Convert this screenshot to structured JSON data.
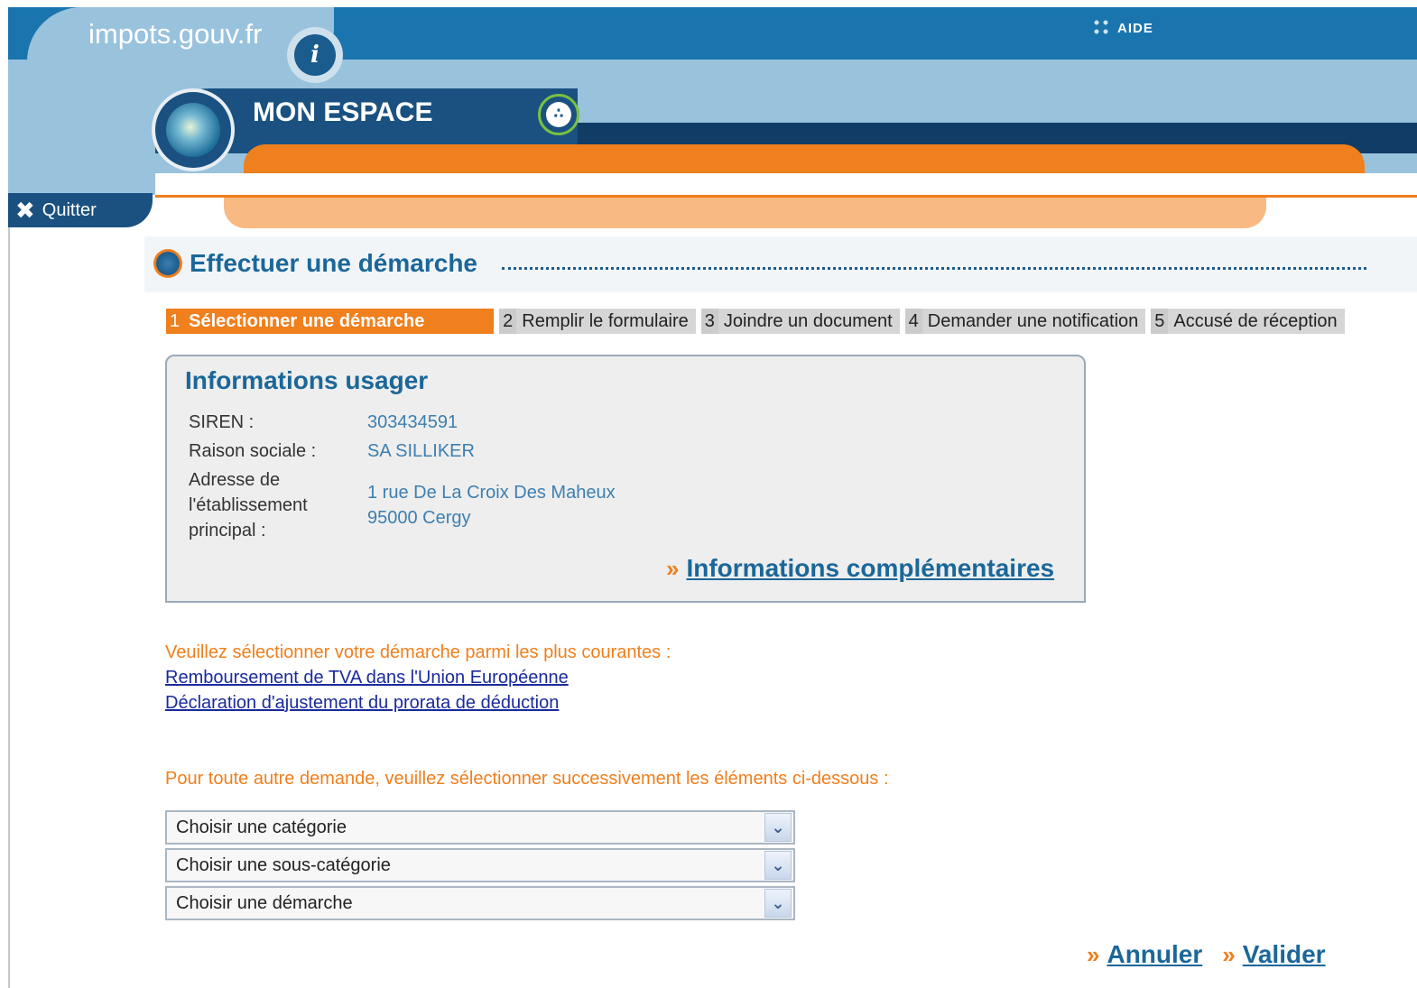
{
  "header": {
    "logo_text": "impots.gouv.fr",
    "logo_mark": "i",
    "help_label": "AIDE",
    "space_title": "MON ESPACE",
    "quit_label": "Quitter"
  },
  "section": {
    "title": "Effectuer une démarche"
  },
  "steps": [
    {
      "num": "1",
      "label": "Sélectionner une démarche",
      "active": true
    },
    {
      "num": "2",
      "label": "Remplir le formulaire",
      "active": false
    },
    {
      "num": "3",
      "label": "Joindre un document",
      "active": false
    },
    {
      "num": "4",
      "label": "Demander une notification",
      "active": false
    },
    {
      "num": "5",
      "label": "Accusé de réception",
      "active": false
    }
  ],
  "user_info": {
    "title": "Informations usager",
    "siren_label": "SIREN :",
    "siren_value": "303434591",
    "raison_label": "Raison sociale :",
    "raison_value": "SA SILLIKER",
    "address_label_1": "Adresse de",
    "address_label_2": "l'établissement",
    "address_label_3": "principal :",
    "address_line1": "1 rue De La Croix Des Maheux",
    "address_line2": "95000 Cergy",
    "more_link": "Informations complémentaires"
  },
  "common": {
    "prompt": "Veuillez sélectionner votre démarche parmi les plus courantes :",
    "links": [
      "Remboursement de TVA dans l'Union Européenne",
      "Déclaration d'ajustement du prorata de déduction"
    ]
  },
  "other": {
    "prompt": "Pour toute autre demande, veuillez sélectionner successivement les éléments ci-dessous :",
    "selects": [
      "Choisir une catégorie",
      "Choisir une sous-catégorie",
      "Choisir une démarche"
    ]
  },
  "actions": {
    "cancel": "Annuler",
    "validate": "Valider"
  },
  "colors": {
    "brand_blue": "#1a75ae",
    "dark_blue": "#1a5180",
    "accent_orange": "#f07f1d"
  }
}
